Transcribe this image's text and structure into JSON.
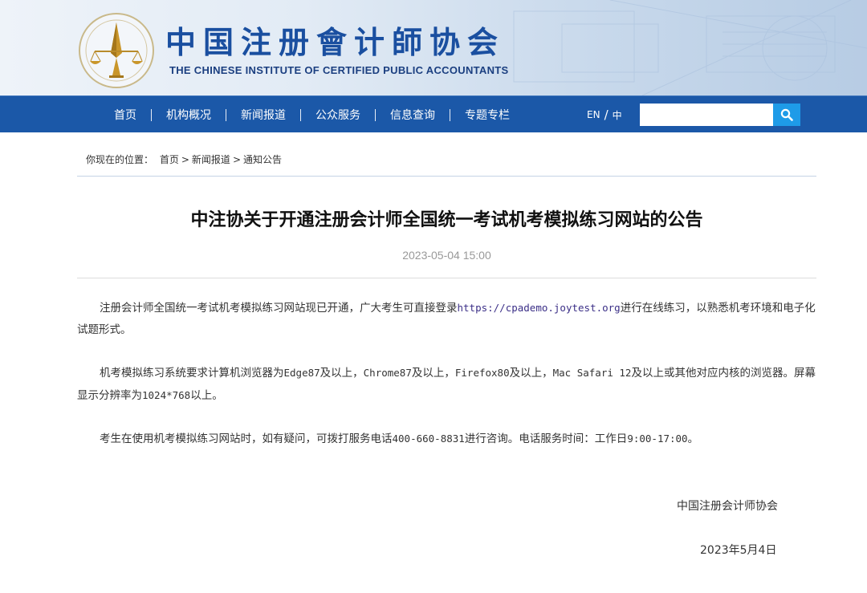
{
  "header": {
    "brand_cn": "中国注册會计師协会",
    "brand_en": "THE CHINESE INSTITUTE OF CERTIFIED PUBLIC ACCOUNTANTS"
  },
  "nav": {
    "items": [
      {
        "label": "首页"
      },
      {
        "label": "机构概况"
      },
      {
        "label": "新闻报道"
      },
      {
        "label": "公众服务"
      },
      {
        "label": "信息查询"
      },
      {
        "label": "专题专栏"
      }
    ],
    "lang_en": "EN",
    "lang_sep": "/",
    "lang_zh": "中",
    "search_placeholder": ""
  },
  "breadcrumb": {
    "prefix": "你现在的位置：",
    "items": [
      "首页",
      "新闻报道",
      "通知公告"
    ],
    "separator": ">"
  },
  "article": {
    "title": "中注协关于开通注册会计师全国统一考试机考模拟练习网站的公告",
    "date": "2023-05-04 15:00",
    "p1_before": "注册会计师全国统一考试机考模拟练习网站现已开通，广大考生可直接登录",
    "p1_link": "https://cpademo.joytest.org",
    "p1_after": "进行在线练习，以熟悉机考环境和电子化试题形式。",
    "p2_a": "机考模拟练习系统要求计算机浏览器为",
    "p2_b": "Edge87",
    "p2_c": "及以上，",
    "p2_d": "Chrome87",
    "p2_e": "及以上，",
    "p2_f": "Firefox80",
    "p2_g": "及以上，",
    "p2_h": "Mac Safari 12",
    "p2_i": "及以上或其他对应内核的浏览器。屏幕显示分辨率为",
    "p2_j": "1024*768",
    "p2_k": "以上。",
    "p3_a": "考生在使用机考模拟练习网站时，如有疑问，可拨打服务电话",
    "p3_b": "400-660-8831",
    "p3_c": "进行咨询。电话服务时间：工作日",
    "p3_d": "9:00-17:00",
    "p3_e": "。",
    "sign_org": "中国注册会计师协会",
    "sign_date": "2023年5月4日"
  },
  "colors": {
    "nav_bg": "#1b58a8",
    "search_button": "#1e9be8",
    "brand": "#1a4fa0",
    "link": "#3b2f87"
  }
}
